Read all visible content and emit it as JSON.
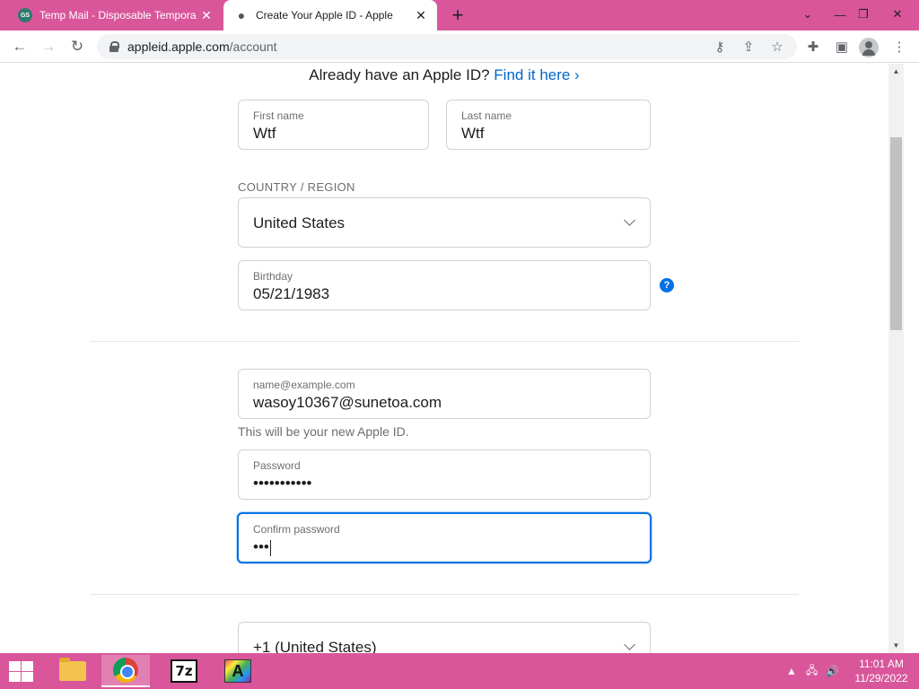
{
  "browser": {
    "tabs": [
      {
        "title": "Temp Mail - Disposable Tempora",
        "favicon_text": "GS"
      },
      {
        "title": "Create Your Apple ID - Apple",
        "favicon_text": ""
      }
    ],
    "url_host": "appleid.apple.com",
    "url_path": "/account"
  },
  "page": {
    "already_text": "Already have an Apple ID?",
    "find_link": "Find it here ›",
    "first_name_label": "First name",
    "first_name_value": "Wtf",
    "last_name_label": "Last name",
    "last_name_value": "Wtf",
    "country_section_label": "COUNTRY / REGION",
    "country_value": "United States",
    "birthday_label": "Birthday",
    "birthday_value": "05/21/1983",
    "help_symbol": "?",
    "email_label": "name@example.com",
    "email_value": "wasoy10367@sunetoa.com",
    "email_hint": "This will be your new Apple ID.",
    "password_label": "Password",
    "password_value": "•••••••••••",
    "confirm_label": "Confirm password",
    "confirm_value": "•••",
    "phone_code_value": "+1 (United States)"
  },
  "taskbar": {
    "time": "11:01 AM",
    "date": "11/29/2022",
    "sevenzip_label": "7z",
    "a_label": "A"
  },
  "colors": {
    "accent_pink": "#d9569b",
    "link_blue": "#0066cc",
    "focus_blue": "#0071e3"
  }
}
